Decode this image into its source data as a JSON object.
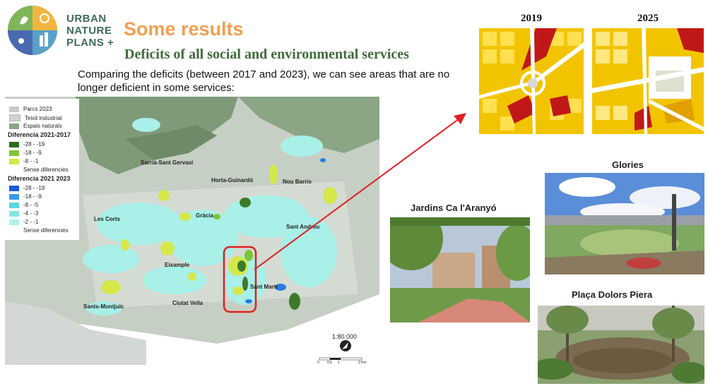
{
  "logo": {
    "line1": "URBAN",
    "line2": "NATURE",
    "line3": "PLANS +"
  },
  "header": {
    "title": "Some results",
    "subtitle": "Deficits of all social and environmental services"
  },
  "intro": "Comparing the deficits (between 2017 and 2023), we can see areas that are no longer deficient in some services:",
  "map": {
    "legend": {
      "base_items": [
        "Parcs 2023",
        "Teixit industrial",
        "Espais naturals"
      ],
      "group1_title": "Diferencia 2021-2017",
      "group1_items": [
        "-28 - -19",
        "-18 - -9",
        "-8 - -1",
        "Sense diferencies"
      ],
      "group2_title": "Diferencia 2021 2023",
      "group2_items": [
        "-28 - -19",
        "-18 - -9",
        "-8 - -5",
        "-4 - -3",
        "-2 - -1",
        "Sense diferencies"
      ]
    },
    "districts": {
      "sarria": "Sarrià-Sant Gervasi",
      "horta": "Horta-Guinardó",
      "nou_barris": "Nou Barris",
      "gracia": "Gràcia",
      "les_corts": "Les Corts",
      "sant_andreu": "Sant Andreu",
      "eixample": "Eixample",
      "sant_marti": "Sant Martí",
      "sants": "Sants-Montjuïc",
      "ciutat_vella": "Ciutat Vella"
    },
    "scale_ratio": "1:80.000",
    "scale_ticks": [
      "0",
      "0,5",
      "1",
      "2 Km"
    ]
  },
  "years": {
    "left": "2019",
    "right": "2025"
  },
  "captions": {
    "glories": "Glories",
    "jardins": "Jardins Ca l'Aranyó",
    "placa": "Plaça Dolors Piera"
  },
  "colors": {
    "title_orange": "#f0a050",
    "subtitle_green": "#3f6b3a",
    "highlight_red": "#e02020"
  }
}
